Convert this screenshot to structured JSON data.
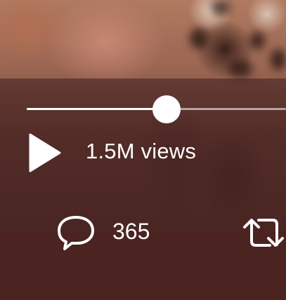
{
  "video": {
    "progress_fraction": 0.54,
    "views_label": "1.5M views"
  },
  "actions": {
    "reply_count": "365"
  },
  "colors": {
    "icon": "#ffffff",
    "overlay": "#3c1e1c",
    "bottom_bar": "#4b2321"
  },
  "icons": {
    "play": "play-icon",
    "reply": "speech-bubble-icon",
    "retweet": "retweet-arrows-icon"
  }
}
